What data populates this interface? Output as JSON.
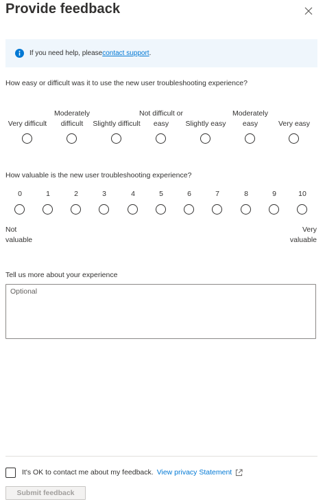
{
  "header": {
    "title": "Provide feedback",
    "close_icon": "close-icon"
  },
  "info": {
    "icon": "info-icon",
    "text": "If you need help, please ",
    "link_text": "contact support",
    "suffix": "."
  },
  "difficulty": {
    "question": "How easy or difficult was it to use the new user troubleshooting experience?",
    "options": [
      "Very difficult",
      "Moderately difficult",
      "Slightly difficult",
      "Not difficult or easy",
      "Slightly easy",
      "Moderately easy",
      "Very easy"
    ]
  },
  "value": {
    "question": "How valuable is the new user troubleshooting experience?",
    "scale": [
      "0",
      "1",
      "2",
      "3",
      "4",
      "5",
      "6",
      "7",
      "8",
      "9",
      "10"
    ],
    "low_label": "Not valuable",
    "high_label": "Very valuable"
  },
  "comments": {
    "label": "Tell us more about your experience",
    "placeholder": "Optional",
    "value": ""
  },
  "footer": {
    "consent_text": "It's OK to contact me about my feedback.",
    "privacy_link": "View privacy Statement",
    "external_icon": "external-link-icon",
    "submit_label": "Submit feedback",
    "submit_enabled": false
  },
  "colors": {
    "accent": "#0078d4",
    "info_background": "#eff6fc",
    "text": "#323130",
    "disabled_text": "#a19f9d"
  }
}
